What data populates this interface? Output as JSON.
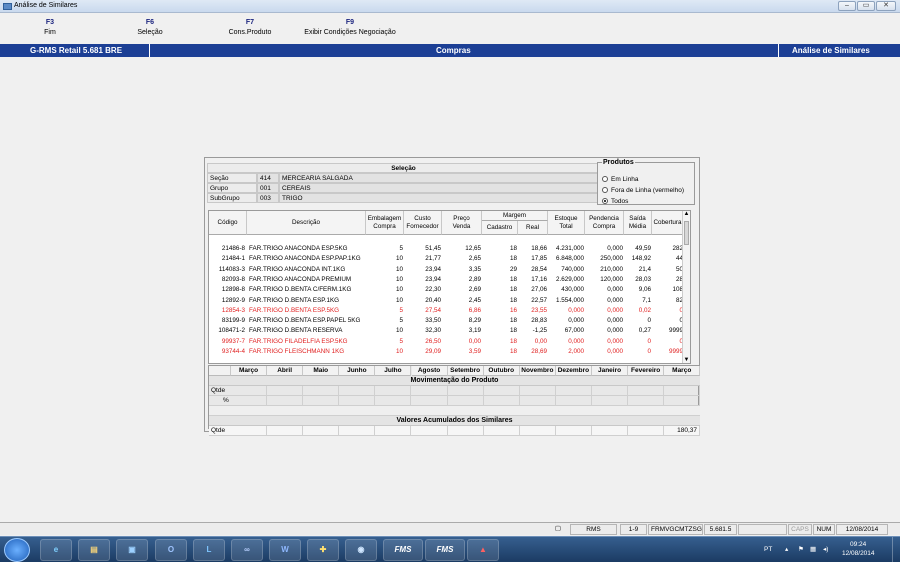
{
  "window": {
    "title": "Análise de Similares"
  },
  "fkeys": [
    {
      "key": "F3",
      "label": "Fim"
    },
    {
      "key": "F6",
      "label": "Seleção"
    },
    {
      "key": "F7",
      "label": "Cons.Produto"
    },
    {
      "key": "F9",
      "label": "Exibir Condições Negociação"
    }
  ],
  "header": {
    "app": "G-RMS Retail 5.681 BRE",
    "module": "Compras",
    "screen": "Análise de Similares"
  },
  "selecao": {
    "title": "Seleção",
    "rows": [
      {
        "label": "Seção",
        "code": "414",
        "name": "MERCEARIA SALGADA"
      },
      {
        "label": "Grupo",
        "code": "001",
        "name": "CEREAIS"
      },
      {
        "label": "SubGrupo",
        "code": "003",
        "name": "TRIGO"
      }
    ]
  },
  "produtos": {
    "title": "Produtos",
    "options": [
      "Em Linha",
      "Fora de Linha (vermelho)",
      "Todos"
    ],
    "selected": "Todos"
  },
  "grid": {
    "headers": {
      "codigo": "Código",
      "descricao": "Descrição",
      "embalagem": [
        "Embalagem",
        "Compra"
      ],
      "custo": [
        "Custo",
        "Fornecedor"
      ],
      "preco": [
        "Preço",
        "Venda"
      ],
      "margem": "Margem",
      "cadastro": "Cadastro",
      "real": "Real",
      "estoque": [
        "Estoque",
        "Total"
      ],
      "pendencia": [
        "Pendencia",
        "Compra"
      ],
      "saida": [
        "Saída",
        "Média"
      ],
      "cobertura": "Cobertura"
    },
    "rows": [
      {
        "codigo": "21486-8",
        "descricao": "FAR.TRIGO ANACONDA ESP.5KG",
        "embalagem": "5",
        "custo": "51,45",
        "preco": "12,65",
        "cadastro": "18",
        "real": "18,66",
        "estoque": "4.231,000",
        "pendencia": "0,000",
        "saida": "49,59",
        "cobertura": "282",
        "red": false
      },
      {
        "codigo": "21484-1",
        "descricao": "FAR.TRIGO ANACONDA ESP.PAP.1KG",
        "embalagem": "10",
        "custo": "21,77",
        "preco": "2,65",
        "cadastro": "18",
        "real": "17,85",
        "estoque": "6.848,000",
        "pendencia": "250,000",
        "saida": "148,92",
        "cobertura": "44",
        "red": false
      },
      {
        "codigo": "114083-3",
        "descricao": "FAR.TRIGO ANACONDA INT.1KG",
        "embalagem": "10",
        "custo": "23,94",
        "preco": "3,35",
        "cadastro": "29",
        "real": "28,54",
        "estoque": "740,000",
        "pendencia": "210,000",
        "saida": "21,4",
        "cobertura": "50",
        "red": false
      },
      {
        "codigo": "82093-8",
        "descricao": "FAR.TRIGO ANACONDA PREMIUM",
        "embalagem": "10",
        "custo": "23,94",
        "preco": "2,89",
        "cadastro": "18",
        "real": "17,16",
        "estoque": "2.629,000",
        "pendencia": "120,000",
        "saida": "28,03",
        "cobertura": "28",
        "red": false
      },
      {
        "codigo": "12898-8",
        "descricao": "FAR.TRIGO D.BENTA C/FERM.1KG",
        "embalagem": "10",
        "custo": "22,30",
        "preco": "2,69",
        "cadastro": "18",
        "real": "27,06",
        "estoque": "430,000",
        "pendencia": "0,000",
        "saida": "9,06",
        "cobertura": "108",
        "red": false
      },
      {
        "codigo": "12892-9",
        "descricao": "FAR.TRIGO D.BENTA ESP.1KG",
        "embalagem": "10",
        "custo": "20,40",
        "preco": "2,45",
        "cadastro": "18",
        "real": "22,57",
        "estoque": "1.554,000",
        "pendencia": "0,000",
        "saida": "7,1",
        "cobertura": "82",
        "red": false
      },
      {
        "codigo": "12854-3",
        "descricao": "FAR.TRIGO D.BENTA ESP.5KG",
        "embalagem": "5",
        "custo": "27,54",
        "preco": "6,86",
        "cadastro": "16",
        "real": "23,55",
        "estoque": "0,000",
        "pendencia": "0,000",
        "saida": "0,02",
        "cobertura": "0",
        "red": true
      },
      {
        "codigo": "83199-9",
        "descricao": "FAR.TRIGO D.BENTA ESP.PAPEL 5KG",
        "embalagem": "5",
        "custo": "33,50",
        "preco": "8,29",
        "cadastro": "18",
        "real": "28,83",
        "estoque": "0,000",
        "pendencia": "0,000",
        "saida": "0",
        "cobertura": "0",
        "red": false
      },
      {
        "codigo": "108471-2",
        "descricao": "FAR.TRIGO D.BENTA RESERVA",
        "embalagem": "10",
        "custo": "32,30",
        "preco": "3,19",
        "cadastro": "18",
        "real": "-1,25",
        "estoque": "67,000",
        "pendencia": "0,000",
        "saida": "0,27",
        "cobertura": "9999",
        "red": false
      },
      {
        "codigo": "99937-7",
        "descricao": "FAR.TRIGO FILADELFIA ESP.5KG",
        "embalagem": "5",
        "custo": "26,50",
        "preco": "0,00",
        "cadastro": "18",
        "real": "0,00",
        "estoque": "0,000",
        "pendencia": "0,000",
        "saida": "0",
        "cobertura": "0",
        "red": true
      },
      {
        "codigo": "93744-4",
        "descricao": "FAR.TRIGO FLEISCHMANN 1KG",
        "embalagem": "10",
        "custo": "29,09",
        "preco": "3,59",
        "cadastro": "18",
        "real": "28,69",
        "estoque": "2,000",
        "pendencia": "0,000",
        "saida": "0",
        "cobertura": "9999",
        "red": true
      }
    ]
  },
  "meses": {
    "headers": [
      "Março",
      "Abril",
      "Maio",
      "Junho",
      "Julho",
      "Agosto",
      "Setembro",
      "Outubro",
      "Novembro",
      "Dezembro",
      "Janeiro",
      "Fevereiro",
      "Março"
    ],
    "mov_title": "Movimentação do Produto",
    "row_qtde": "Qtde",
    "row_pct": "%",
    "acum_title": "Valores Acumulados dos Similares",
    "acum_qtde": "Qtde",
    "acum_value": "180,37"
  },
  "statusbar": {
    "rms": "RMS",
    "page": "1-9",
    "user": "FRMVGCMTZSG",
    "version": "5.681.5",
    "caps": "CAPS",
    "num": "NUM",
    "date": "12/08/2014"
  },
  "taskbar": {
    "lang": "PT",
    "time": "09:24",
    "date": "12/08/2014",
    "fms1": "FMS",
    "fms2": "FMS"
  }
}
